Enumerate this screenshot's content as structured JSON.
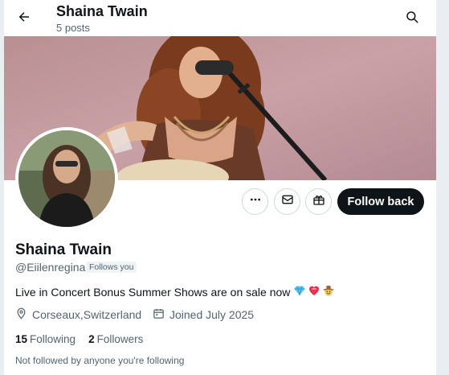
{
  "header": {
    "title": "Shaina Twain",
    "subtitle": "5 posts"
  },
  "profile": {
    "name": "Shaina Twain",
    "handle": "@Eiilenregina",
    "follows_you": "Follows you",
    "bio": "Live in Concert Bonus Summer Shows are on sale now",
    "bio_emojis": [
      "diamond",
      "heart-with-ribbon",
      "cowboy-face"
    ],
    "location": "Corseaux,Switzerland",
    "joined": "Joined July 2025",
    "following_count": "15",
    "following_label": "Following",
    "followers_count": "2",
    "followers_label": "Followers",
    "not_followed_note": "Not followed by anyone you're following"
  },
  "actions": {
    "follow_back_label": "Follow back"
  },
  "icons": {
    "back": "arrow-left-icon",
    "search": "search-icon",
    "more": "more-dots-icon",
    "message": "envelope-icon",
    "subscribe": "gift-icon",
    "location": "location-pin-icon",
    "calendar": "calendar-icon"
  },
  "colors": {
    "primary_text": "#0f1419",
    "secondary_text": "#536471",
    "follow_button_bg": "#0f1419",
    "border": "#cfd9de"
  }
}
